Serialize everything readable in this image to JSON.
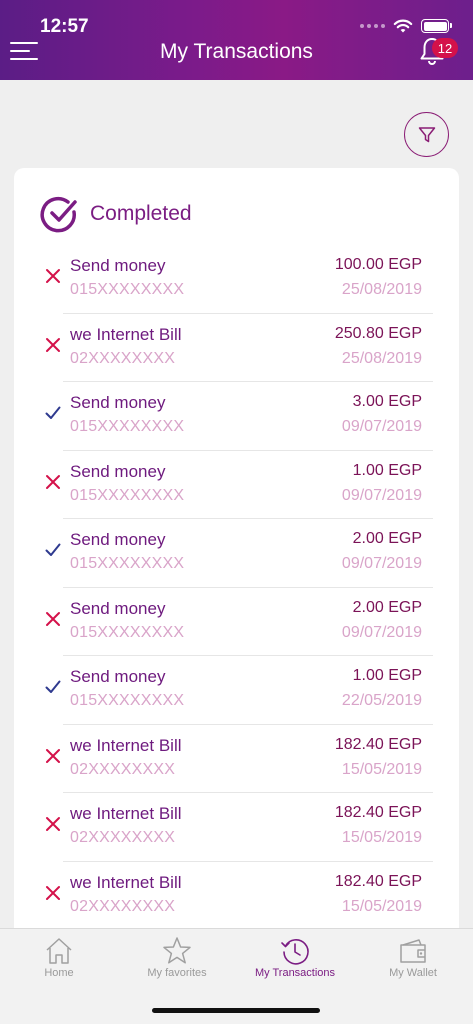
{
  "status_bar": {
    "time": "12:57"
  },
  "header": {
    "title": "My Transactions",
    "notification_count": "12"
  },
  "section": {
    "title": "Completed"
  },
  "transactions": [
    {
      "status": "failed",
      "title": "Send money",
      "number": "015XXXXXXXX",
      "amount": "100.00 EGP",
      "date": "25/08/2019"
    },
    {
      "status": "failed",
      "title": "we Internet Bill",
      "number": "02XXXXXXXX",
      "amount": "250.80 EGP",
      "date": "25/08/2019"
    },
    {
      "status": "success",
      "title": "Send money",
      "number": "015XXXXXXXX",
      "amount": "3.00 EGP",
      "date": "09/07/2019"
    },
    {
      "status": "failed",
      "title": "Send money",
      "number": "015XXXXXXXX",
      "amount": "1.00 EGP",
      "date": "09/07/2019"
    },
    {
      "status": "success",
      "title": "Send money",
      "number": "015XXXXXXXX",
      "amount": "2.00 EGP",
      "date": "09/07/2019"
    },
    {
      "status": "failed",
      "title": "Send money",
      "number": "015XXXXXXXX",
      "amount": "2.00 EGP",
      "date": "09/07/2019"
    },
    {
      "status": "success",
      "title": "Send money",
      "number": "015XXXXXXXX",
      "amount": "1.00 EGP",
      "date": "22/05/2019"
    },
    {
      "status": "failed",
      "title": "we Internet Bill",
      "number": "02XXXXXXXX",
      "amount": "182.40 EGP",
      "date": "15/05/2019"
    },
    {
      "status": "failed",
      "title": "we Internet Bill",
      "number": "02XXXXXXXX",
      "amount": "182.40 EGP",
      "date": "15/05/2019"
    },
    {
      "status": "failed",
      "title": "we Internet Bill",
      "number": "02XXXXXXXX",
      "amount": "182.40 EGP",
      "date": "15/05/2019"
    }
  ],
  "tabs": [
    {
      "label": "Home",
      "icon": "home-icon",
      "active": false
    },
    {
      "label": "My favorites",
      "icon": "star-icon",
      "active": false
    },
    {
      "label": "My Transactions",
      "icon": "history-icon",
      "active": true
    },
    {
      "label": "My Wallet",
      "icon": "wallet-icon",
      "active": false
    }
  ],
  "colors": {
    "brand_purple": "#7b1d83",
    "failed_red": "#d4114a",
    "success_blue": "#2f3a8f",
    "muted_pink": "#d9a4c9"
  }
}
